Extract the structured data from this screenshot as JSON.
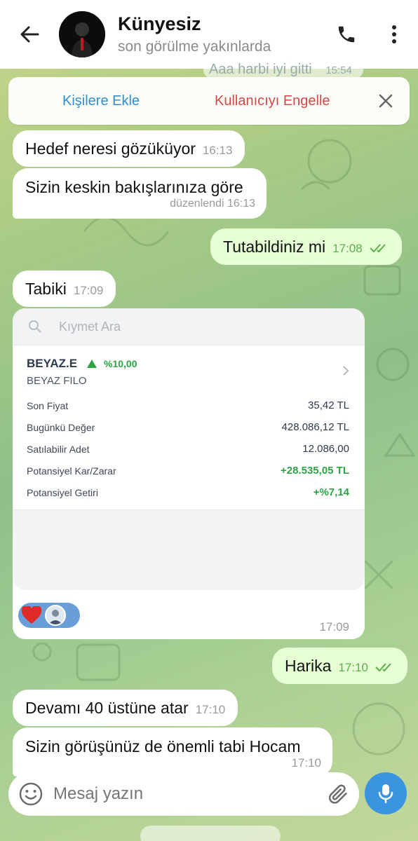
{
  "header": {
    "contact_name": "Künyesiz",
    "status": "son görülme yakınlarda"
  },
  "banner": {
    "add_contact": "Kişilere Ekle",
    "block_user": "Kullanıcıyı Engelle"
  },
  "peek_top_text": "Aaa harbi iyi gitti",
  "peek_top_time": "15:54",
  "messages": [
    {
      "text": "Hedef neresi gözüküyor",
      "time": "16:13"
    },
    {
      "text": "Sizin keskin bakışlarınıza göre",
      "time": "düzenlendi 16:13"
    },
    {
      "text": "Tutabildiniz mi",
      "time": "17:08"
    },
    {
      "text": "Tabiki",
      "time": "17:09"
    },
    {
      "text": "Harika",
      "time": "17:10"
    },
    {
      "text": "Devamı 40 üstüne atar",
      "time": "17:10"
    },
    {
      "text": "Sizin görüşünüz de önemli tabi Hocam",
      "time": "17:10"
    }
  ],
  "card": {
    "search_placeholder": "Kıymet Ara",
    "ticker": "BEYAZ.E",
    "change": "%10,00",
    "company": "BEYAZ FILO",
    "rows": [
      {
        "label": "Son Fiyat",
        "value": "35,42 TL"
      },
      {
        "label": "Bugünkü Değer",
        "value": "428.086,12 TL"
      },
      {
        "label": "Satılabilir Adet",
        "value": "12.086,00"
      },
      {
        "label": "Potansiyel Kar/Zarar",
        "value": "+28.535,05 TL"
      },
      {
        "label": "Potansiyel Getiri",
        "value": "+%7,14"
      }
    ],
    "time": "17:09"
  },
  "composer": {
    "placeholder": "Mesaj yazın"
  },
  "colors": {
    "incoming_bubble": "#ffffff",
    "outgoing_bubble": "#e6ffd4",
    "accent_blue": "#3a94e0",
    "danger_red": "#d14a49",
    "positive_green": "#2aa541"
  }
}
